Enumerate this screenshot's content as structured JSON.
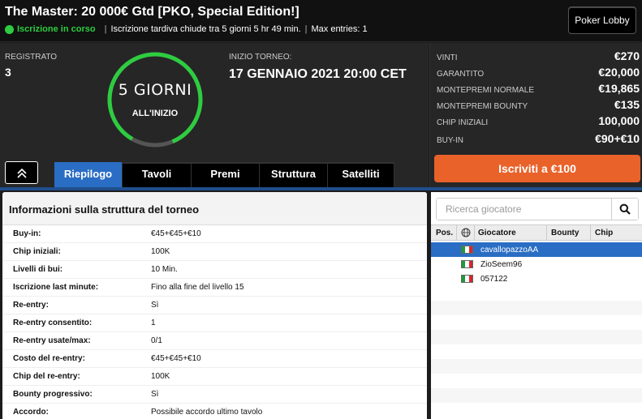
{
  "header": {
    "title": "The Master: 20 000€ Gtd [PKO, Special Edition!]",
    "status": "Iscrizione in corso",
    "late_reg": "Iscrizione tardiva chiude tra 5 giorni 5 hr 49 min.",
    "max_entries": "Max entries: 1",
    "separator": "|",
    "lobby_button": "Poker Lobby",
    "status_color": "#2ecc40"
  },
  "summary": {
    "registered_label": "REGISTRATO",
    "registered_value": "3",
    "countdown_big": "5 GIORNI",
    "countdown_small": "ALL'INIZIO",
    "start_label": "INIZIO TORNEO:",
    "start_value": "17 GENNAIO 2021  20:00 CET"
  },
  "prize": {
    "rows": [
      {
        "label": "VINTI",
        "value": "€270"
      },
      {
        "label": "GARANTITO",
        "value": "€20,000"
      },
      {
        "label": "MONTEPREMI NORMALE",
        "value": "€19,865"
      },
      {
        "label": "MONTEPREMI BOUNTY",
        "value": "€135"
      },
      {
        "label": "CHIP INIZIALI",
        "value": "100,000"
      },
      {
        "label": "BUY-IN",
        "value": "€90+€10"
      }
    ],
    "signup_button": "Iscriviti a €100",
    "signup_color": "#e8622a"
  },
  "collapse_icon": "chevron-double-up-icon",
  "tabs": [
    "Riepilogo",
    "Tavoli",
    "Premi",
    "Struttura",
    "Satelliti"
  ],
  "active_tab": "Riepilogo",
  "info": {
    "title": "Informazioni sulla struttura del torneo",
    "rows": [
      {
        "label": "Buy-in:",
        "value": "€45+€45+€10"
      },
      {
        "label": "Chip iniziali:",
        "value": "100K"
      },
      {
        "label": "Livelli di bui:",
        "value": "10 Min."
      },
      {
        "label": "Iscrizione last minute:",
        "value": "Fino alla fine del livello 15"
      },
      {
        "label": "Re-entry:",
        "value": "Sì"
      },
      {
        "label": "Re-entry consentito:",
        "value": "1"
      },
      {
        "label": "Re-entry usate/max:",
        "value": "0/1"
      },
      {
        "label": "Costo del re-entry:",
        "value": "€45+€45+€10"
      },
      {
        "label": "Chip del re-entry:",
        "value": "100K"
      },
      {
        "label": "Bounty progressivo:",
        "value": "Sì"
      },
      {
        "label": "Accordo:",
        "value": "Possibile accordo ultimo tavolo"
      }
    ]
  },
  "players": {
    "search_placeholder": "Ricerca giocatore",
    "columns": [
      "Pos.",
      "",
      "Giocatore",
      "Bounty",
      "Chip"
    ],
    "list": [
      {
        "name": "cavallopazzoAA",
        "selected": true
      },
      {
        "name": "ZioSeem96",
        "selected": false
      },
      {
        "name": "057122",
        "selected": false
      }
    ],
    "flag": "italy-flag-icon",
    "selected_color": "#2a6dc4"
  }
}
